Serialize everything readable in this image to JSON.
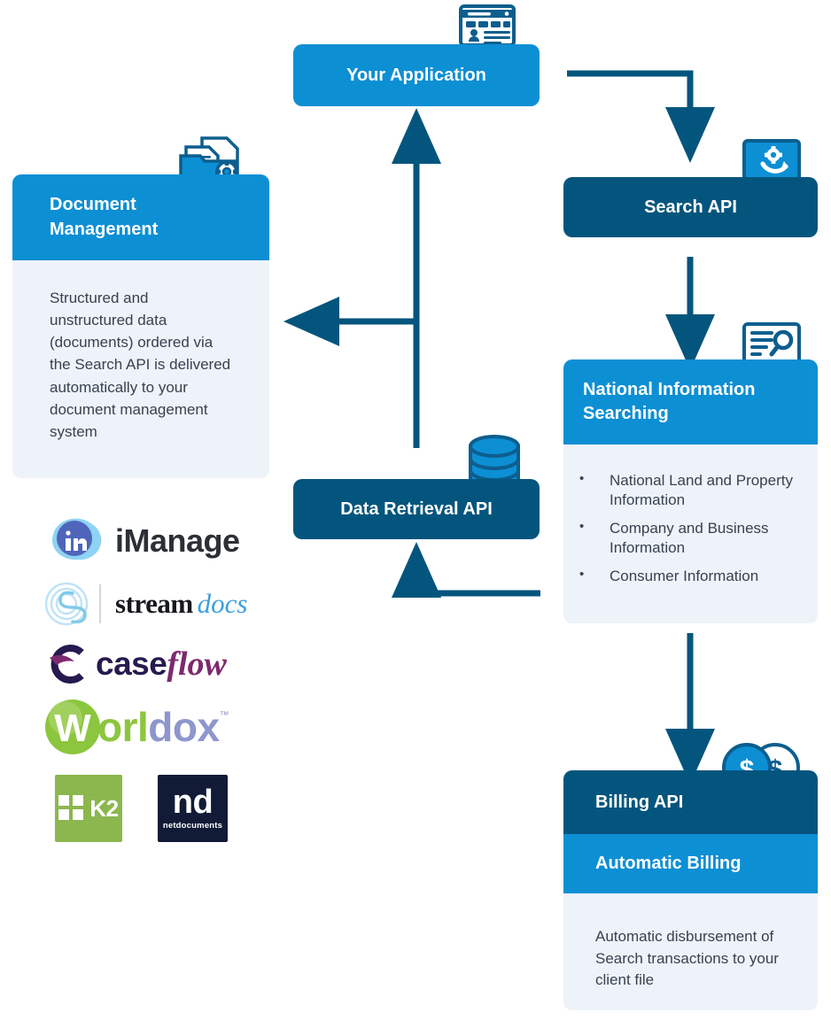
{
  "diagram": {
    "title_boxes": {
      "your_application": "Your Application",
      "search_api": "Search API",
      "data_retrieval_api": "Data Retrieval API"
    },
    "document_management": {
      "heading_line1": "Document",
      "heading_line2": "Management",
      "body": "Structured and unstructured data (documents) ordered via the Search API is delivered automatically to your document management system"
    },
    "national_information": {
      "heading_line1": "National Information",
      "heading_line2": "Searching",
      "bullets": [
        "National Land and Property Information",
        "Company and Business Information",
        "Consumer Information"
      ]
    },
    "billing": {
      "heading_api": "Billing API",
      "heading_auto": "Automatic Billing",
      "body": "Automatic disbursement of Search transactions to your client file"
    },
    "icons": {
      "your_application": "laptop-profile-icon",
      "search_api": "laptop-gear-search-icon",
      "national_information": "laptop-document-magnifier-icon",
      "billing": "dollar-coins-icon",
      "document_management": "folder-documents-gear-hand-icon",
      "data_retrieval": "database-cylinder-icon"
    },
    "partner_logos": [
      {
        "name": "iManage",
        "text": "iManage",
        "mark": "imanage-mark"
      },
      {
        "name": "streamdocs",
        "text_a": "stream",
        "text_b": "docs",
        "mark": "streamdocs-fingerprint-mark"
      },
      {
        "name": "caseflow",
        "text_a": "case",
        "text_b": "flow",
        "mark": "caseflow-c-mark"
      },
      {
        "name": "Worldox",
        "text_a": "W",
        "text_b": "orl",
        "text_c": "dox",
        "text_d": "™",
        "mark": "worldox-w-mark"
      },
      {
        "name": "K2",
        "text": "K2",
        "mark": "k2-squares-mark"
      },
      {
        "name": "NetDocuments",
        "text_a": "nd",
        "text_b": "netdocuments",
        "mark": "netdocuments-mark"
      }
    ],
    "colors": {
      "bright_blue": "#0d8fd4",
      "navy": "#04557d",
      "panel": "#eef2f9",
      "text": "#38424f",
      "white": "#ffffff"
    },
    "flow_arrows": [
      {
        "from": "Your Application",
        "to": "Search API",
        "direction": "right-then-down"
      },
      {
        "from": "Search API",
        "to": "National Information Searching",
        "direction": "down"
      },
      {
        "from": "National Information Searching",
        "to": "Billing API",
        "direction": "down"
      },
      {
        "from": "National Information Searching",
        "to": "Data Retrieval API",
        "direction": "left-then-up"
      },
      {
        "from": "Data Retrieval API",
        "to": "Your Application",
        "direction": "up"
      },
      {
        "from": "Data Retrieval API",
        "to": "Document Management",
        "direction": "left"
      }
    ]
  }
}
